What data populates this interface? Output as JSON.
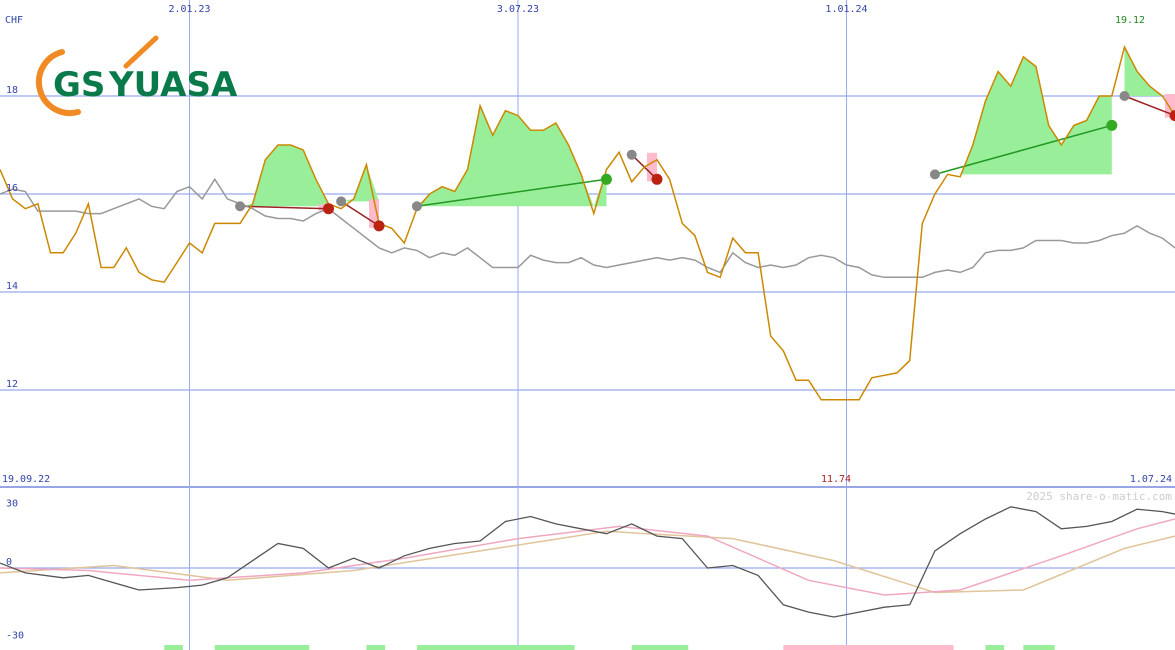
{
  "chart_data": {
    "type": "line",
    "currency_label": "CHF",
    "watermark": "2025 share-o-matic.com",
    "logo": {
      "text_a": "GS",
      "text_b": "YUASA",
      "color_green": "#0a7a4a",
      "color_orange": "#f08a24"
    },
    "colors": {
      "price": "#cc8800",
      "comparison": "#999999",
      "grid": "#99aaee",
      "gain_fill": "#99ee99",
      "loss_fill": "#ffbbcc",
      "gain_line": "#229922",
      "loss_line": "#992222"
    },
    "top_date_labels": [
      "2.01.23",
      "3.07.23",
      "1.01.24"
    ],
    "bottom_date_labels": {
      "start": "19.09.22",
      "end": "1.07.24"
    },
    "high_label": "19.12",
    "low_label": "11.74",
    "price_axis": {
      "ymin": 10.0,
      "ymax": 19.5,
      "ticks": [
        "18",
        "16",
        "14",
        "12"
      ],
      "tick_values": [
        18,
        16,
        14,
        12
      ]
    },
    "oscillator_axis": {
      "ymin": -30,
      "ymax": 30,
      "ticks": [
        "30",
        "0",
        "-30"
      ],
      "tick_values": [
        30,
        0,
        -30
      ]
    },
    "x": {
      "start": "2022-09-19",
      "end": "2024-07-01",
      "vertical_gridlines": [
        "2023-01-02",
        "2023-07-03",
        "2024-01-01"
      ]
    },
    "price_series": [
      [
        "2022-09-19",
        16.5
      ],
      [
        "2022-09-26",
        15.9
      ],
      [
        "2022-10-03",
        15.7
      ],
      [
        "2022-10-10",
        15.8
      ],
      [
        "2022-10-17",
        14.8
      ],
      [
        "2022-10-24",
        14.8
      ],
      [
        "2022-10-31",
        15.2
      ],
      [
        "2022-11-07",
        15.8
      ],
      [
        "2022-11-14",
        14.5
      ],
      [
        "2022-11-21",
        14.5
      ],
      [
        "2022-11-28",
        14.9
      ],
      [
        "2022-12-05",
        14.4
      ],
      [
        "2022-12-12",
        14.25
      ],
      [
        "2022-12-19",
        14.2
      ],
      [
        "2022-12-26",
        14.6
      ],
      [
        "2023-01-02",
        15.0
      ],
      [
        "2023-01-09",
        14.8
      ],
      [
        "2023-01-16",
        15.4
      ],
      [
        "2023-01-23",
        15.4
      ],
      [
        "2023-01-30",
        15.4
      ],
      [
        "2023-02-06",
        15.8
      ],
      [
        "2023-02-13",
        16.7
      ],
      [
        "2023-02-20",
        17.0
      ],
      [
        "2023-02-27",
        17.0
      ],
      [
        "2023-03-06",
        16.9
      ],
      [
        "2023-03-13",
        16.3
      ],
      [
        "2023-03-20",
        15.8
      ],
      [
        "2023-03-27",
        15.7
      ],
      [
        "2023-04-03",
        15.9
      ],
      [
        "2023-04-10",
        16.6
      ],
      [
        "2023-04-17",
        15.4
      ],
      [
        "2023-04-24",
        15.3
      ],
      [
        "2023-05-01",
        15.0
      ],
      [
        "2023-05-08",
        15.7
      ],
      [
        "2023-05-15",
        16.0
      ],
      [
        "2023-05-22",
        16.15
      ],
      [
        "2023-05-29",
        16.05
      ],
      [
        "2023-06-05",
        16.5
      ],
      [
        "2023-06-12",
        17.8
      ],
      [
        "2023-06-19",
        17.2
      ],
      [
        "2023-06-26",
        17.7
      ],
      [
        "2023-07-03",
        17.6
      ],
      [
        "2023-07-10",
        17.3
      ],
      [
        "2023-07-17",
        17.3
      ],
      [
        "2023-07-24",
        17.45
      ],
      [
        "2023-07-31",
        17.0
      ],
      [
        "2023-08-07",
        16.4
      ],
      [
        "2023-08-14",
        15.6
      ],
      [
        "2023-08-21",
        16.5
      ],
      [
        "2023-08-28",
        16.85
      ],
      [
        "2023-09-04",
        16.25
      ],
      [
        "2023-09-11",
        16.55
      ],
      [
        "2023-09-18",
        16.7
      ],
      [
        "2023-09-25",
        16.3
      ],
      [
        "2023-10-02",
        15.4
      ],
      [
        "2023-10-09",
        15.15
      ],
      [
        "2023-10-16",
        14.4
      ],
      [
        "2023-10-23",
        14.3
      ],
      [
        "2023-10-30",
        15.1
      ],
      [
        "2023-11-06",
        14.8
      ],
      [
        "2023-11-13",
        14.8
      ],
      [
        "2023-11-20",
        13.1
      ],
      [
        "2023-11-27",
        12.8
      ],
      [
        "2023-12-04",
        12.2
      ],
      [
        "2023-12-11",
        12.2
      ],
      [
        "2023-12-18",
        11.8
      ],
      [
        "2023-12-25",
        11.8
      ],
      [
        "2024-01-01",
        11.8
      ],
      [
        "2024-01-08",
        11.8
      ],
      [
        "2024-01-15",
        12.25
      ],
      [
        "2024-01-22",
        12.3
      ],
      [
        "2024-01-29",
        12.35
      ],
      [
        "2024-02-05",
        12.6
      ],
      [
        "2024-02-12",
        15.4
      ],
      [
        "2024-02-19",
        16.0
      ],
      [
        "2024-02-26",
        16.4
      ],
      [
        "2024-03-04",
        16.35
      ],
      [
        "2024-03-11",
        17.0
      ],
      [
        "2024-03-18",
        17.9
      ],
      [
        "2024-03-25",
        18.5
      ],
      [
        "2024-04-01",
        18.2
      ],
      [
        "2024-04-08",
        18.8
      ],
      [
        "2024-04-15",
        18.6
      ],
      [
        "2024-04-22",
        17.4
      ],
      [
        "2024-04-29",
        17.0
      ],
      [
        "2024-05-06",
        17.4
      ],
      [
        "2024-05-13",
        17.5
      ],
      [
        "2024-05-20",
        18.0
      ],
      [
        "2024-05-27",
        18.0
      ],
      [
        "2024-06-03",
        19.0
      ],
      [
        "2024-06-10",
        18.5
      ],
      [
        "2024-06-17",
        18.2
      ],
      [
        "2024-06-24",
        18.0
      ],
      [
        "2024-07-01",
        17.6
      ]
    ],
    "comparison_series": [
      [
        "2022-09-19",
        16.0
      ],
      [
        "2022-09-26",
        16.1
      ],
      [
        "2022-10-03",
        16.05
      ],
      [
        "2022-10-10",
        15.65
      ],
      [
        "2022-10-17",
        15.65
      ],
      [
        "2022-10-24",
        15.65
      ],
      [
        "2022-10-31",
        15.65
      ],
      [
        "2022-11-07",
        15.6
      ],
      [
        "2022-11-14",
        15.6
      ],
      [
        "2022-11-21",
        15.7
      ],
      [
        "2022-11-28",
        15.8
      ],
      [
        "2022-12-05",
        15.9
      ],
      [
        "2022-12-12",
        15.75
      ],
      [
        "2022-12-19",
        15.7
      ],
      [
        "2022-12-26",
        16.05
      ],
      [
        "2023-01-02",
        16.15
      ],
      [
        "2023-01-09",
        15.9
      ],
      [
        "2023-01-16",
        16.3
      ],
      [
        "2023-01-23",
        15.9
      ],
      [
        "2023-01-30",
        15.8
      ],
      [
        "2023-02-06",
        15.7
      ],
      [
        "2023-02-13",
        15.55
      ],
      [
        "2023-02-20",
        15.5
      ],
      [
        "2023-02-27",
        15.5
      ],
      [
        "2023-03-06",
        15.45
      ],
      [
        "2023-03-13",
        15.6
      ],
      [
        "2023-03-20",
        15.7
      ],
      [
        "2023-03-27",
        15.5
      ],
      [
        "2023-04-03",
        15.3
      ],
      [
        "2023-04-10",
        15.1
      ],
      [
        "2023-04-17",
        14.9
      ],
      [
        "2023-04-24",
        14.8
      ],
      [
        "2023-05-01",
        14.9
      ],
      [
        "2023-05-08",
        14.85
      ],
      [
        "2023-05-15",
        14.7
      ],
      [
        "2023-05-22",
        14.8
      ],
      [
        "2023-05-29",
        14.75
      ],
      [
        "2023-06-05",
        14.9
      ],
      [
        "2023-06-12",
        14.7
      ],
      [
        "2023-06-19",
        14.5
      ],
      [
        "2023-06-26",
        14.5
      ],
      [
        "2023-07-03",
        14.5
      ],
      [
        "2023-07-10",
        14.75
      ],
      [
        "2023-07-17",
        14.65
      ],
      [
        "2023-07-24",
        14.6
      ],
      [
        "2023-07-31",
        14.6
      ],
      [
        "2023-08-07",
        14.7
      ],
      [
        "2023-08-14",
        14.55
      ],
      [
        "2023-08-21",
        14.5
      ],
      [
        "2023-08-28",
        14.55
      ],
      [
        "2023-09-04",
        14.6
      ],
      [
        "2023-09-11",
        14.65
      ],
      [
        "2023-09-18",
        14.7
      ],
      [
        "2023-09-25",
        14.65
      ],
      [
        "2023-10-02",
        14.7
      ],
      [
        "2023-10-09",
        14.65
      ],
      [
        "2023-10-16",
        14.5
      ],
      [
        "2023-10-23",
        14.4
      ],
      [
        "2023-10-30",
        14.8
      ],
      [
        "2023-11-06",
        14.6
      ],
      [
        "2023-11-13",
        14.5
      ],
      [
        "2023-11-20",
        14.55
      ],
      [
        "2023-11-27",
        14.5
      ],
      [
        "2023-12-04",
        14.55
      ],
      [
        "2023-12-11",
        14.7
      ],
      [
        "2023-12-18",
        14.75
      ],
      [
        "2023-12-25",
        14.7
      ],
      [
        "2024-01-01",
        14.55
      ],
      [
        "2024-01-08",
        14.5
      ],
      [
        "2024-01-15",
        14.35
      ],
      [
        "2024-01-22",
        14.3
      ],
      [
        "2024-01-29",
        14.3
      ],
      [
        "2024-02-05",
        14.3
      ],
      [
        "2024-02-12",
        14.3
      ],
      [
        "2024-02-19",
        14.4
      ],
      [
        "2024-02-26",
        14.45
      ],
      [
        "2024-03-04",
        14.4
      ],
      [
        "2024-03-11",
        14.5
      ],
      [
        "2024-03-18",
        14.8
      ],
      [
        "2024-03-25",
        14.85
      ],
      [
        "2024-04-01",
        14.85
      ],
      [
        "2024-04-08",
        14.9
      ],
      [
        "2024-04-15",
        15.05
      ],
      [
        "2024-04-22",
        15.05
      ],
      [
        "2024-04-29",
        15.05
      ],
      [
        "2024-05-06",
        15.0
      ],
      [
        "2024-05-13",
        15.0
      ],
      [
        "2024-05-20",
        15.05
      ],
      [
        "2024-05-27",
        15.15
      ],
      [
        "2024-06-03",
        15.2
      ],
      [
        "2024-06-10",
        15.35
      ],
      [
        "2024-06-17",
        15.2
      ],
      [
        "2024-06-24",
        15.1
      ],
      [
        "2024-07-01",
        14.9
      ]
    ],
    "oscillator_main": [
      [
        "2022-09-19",
        2
      ],
      [
        "2022-10-03",
        -2
      ],
      [
        "2022-10-24",
        -4
      ],
      [
        "2022-11-07",
        -3
      ],
      [
        "2022-11-21",
        -6
      ],
      [
        "2022-12-05",
        -9
      ],
      [
        "2022-12-26",
        -8
      ],
      [
        "2023-01-09",
        -7
      ],
      [
        "2023-01-23",
        -4
      ],
      [
        "2023-02-06",
        3
      ],
      [
        "2023-02-20",
        10
      ],
      [
        "2023-03-06",
        8
      ],
      [
        "2023-03-20",
        0
      ],
      [
        "2023-04-03",
        4
      ],
      [
        "2023-04-17",
        0
      ],
      [
        "2023-05-01",
        5
      ],
      [
        "2023-05-15",
        8
      ],
      [
        "2023-05-29",
        10
      ],
      [
        "2023-06-12",
        11
      ],
      [
        "2023-06-26",
        19
      ],
      [
        "2023-07-10",
        21
      ],
      [
        "2023-07-24",
        18
      ],
      [
        "2023-08-07",
        16
      ],
      [
        "2023-08-21",
        14
      ],
      [
        "2023-09-04",
        18
      ],
      [
        "2023-09-18",
        13
      ],
      [
        "2023-10-02",
        12
      ],
      [
        "2023-10-16",
        0
      ],
      [
        "2023-10-30",
        1
      ],
      [
        "2023-11-13",
        -3
      ],
      [
        "2023-11-27",
        -15
      ],
      [
        "2023-12-11",
        -18
      ],
      [
        "2023-12-25",
        -20
      ],
      [
        "2024-01-08",
        -18
      ],
      [
        "2024-01-22",
        -16
      ],
      [
        "2024-02-05",
        -15
      ],
      [
        "2024-02-19",
        7
      ],
      [
        "2024-03-04",
        14
      ],
      [
        "2024-03-18",
        20
      ],
      [
        "2024-04-01",
        25
      ],
      [
        "2024-04-15",
        23
      ],
      [
        "2024-04-29",
        16
      ],
      [
        "2024-05-13",
        17
      ],
      [
        "2024-05-27",
        19
      ],
      [
        "2024-06-10",
        24
      ],
      [
        "2024-06-24",
        23
      ],
      [
        "2024-07-01",
        22
      ]
    ],
    "oscillator_signal_pink": [
      [
        "2022-09-19",
        0
      ],
      [
        "2022-11-07",
        -1
      ],
      [
        "2023-01-02",
        -5
      ],
      [
        "2023-03-06",
        -2
      ],
      [
        "2023-05-01",
        4
      ],
      [
        "2023-07-03",
        12
      ],
      [
        "2023-08-28",
        17
      ],
      [
        "2023-10-16",
        13
      ],
      [
        "2023-12-11",
        -5
      ],
      [
        "2024-01-22",
        -11
      ],
      [
        "2024-03-04",
        -9
      ],
      [
        "2024-04-29",
        5
      ],
      [
        "2024-06-10",
        16
      ],
      [
        "2024-07-01",
        20
      ]
    ],
    "oscillator_signal_tan": [
      [
        "2022-09-19",
        -2
      ],
      [
        "2022-11-21",
        1
      ],
      [
        "2023-01-23",
        -5
      ],
      [
        "2023-04-03",
        -1
      ],
      [
        "2023-06-12",
        7
      ],
      [
        "2023-08-21",
        15
      ],
      [
        "2023-10-30",
        12
      ],
      [
        "2023-12-25",
        3
      ],
      [
        "2024-02-19",
        -10
      ],
      [
        "2024-04-08",
        -9
      ],
      [
        "2024-06-03",
        8
      ],
      [
        "2024-07-01",
        13
      ]
    ],
    "trades": [
      {
        "start": [
          "2023-01-30",
          15.75
        ],
        "end": [
          "2023-03-20",
          15.7
        ],
        "result": "loss"
      },
      {
        "start": [
          "2023-03-27",
          15.85
        ],
        "end": [
          "2023-04-17",
          15.35
        ],
        "result": "loss"
      },
      {
        "start": [
          "2023-05-08",
          15.75
        ],
        "end": [
          "2023-08-21",
          16.3
        ],
        "result": "gain"
      },
      {
        "start": [
          "2023-09-04",
          16.8
        ],
        "end": [
          "2023-09-18",
          16.3
        ],
        "result": "loss"
      },
      {
        "start": [
          "2024-02-19",
          16.4
        ],
        "end": [
          "2024-05-27",
          17.4
        ],
        "result": "gain"
      },
      {
        "start": [
          "2024-06-03",
          18.0
        ],
        "end": [
          "2024-07-01",
          17.6
        ],
        "result": "loss"
      }
    ],
    "volume_bars": [
      {
        "from": "2022-12-19",
        "to": "2022-12-26",
        "kind": "gain"
      },
      {
        "from": "2023-01-16",
        "to": "2023-03-06",
        "kind": "gain"
      },
      {
        "from": "2023-04-10",
        "to": "2023-04-17",
        "kind": "gain"
      },
      {
        "from": "2023-05-08",
        "to": "2023-07-31",
        "kind": "gain"
      },
      {
        "from": "2023-09-04",
        "to": "2023-10-02",
        "kind": "gain"
      },
      {
        "from": "2023-11-27",
        "to": "2024-02-26",
        "kind": "loss"
      },
      {
        "from": "2024-03-18",
        "to": "2024-03-25",
        "kind": "gain"
      },
      {
        "from": "2024-04-08",
        "to": "2024-04-22",
        "kind": "gain"
      }
    ]
  }
}
